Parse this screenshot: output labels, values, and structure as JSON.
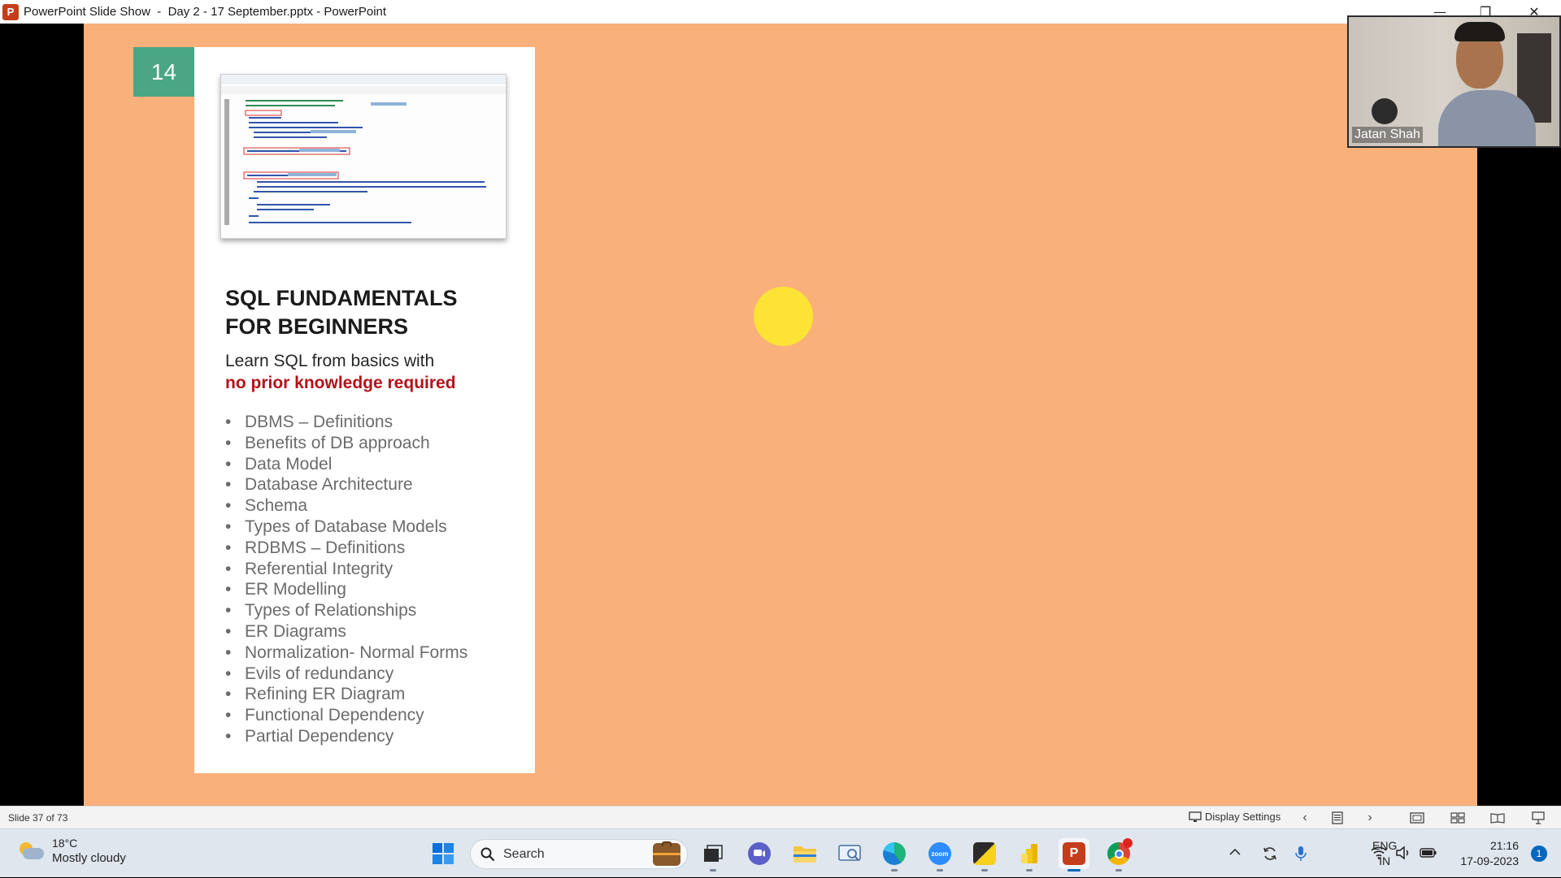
{
  "window": {
    "app_letter": "P",
    "title": "PowerPoint Slide Show  -  Day 2 - 17 September.pptx - PowerPoint",
    "controls": {
      "minimize": "—",
      "restore": "❐",
      "close": "✕"
    }
  },
  "slide": {
    "number": "14",
    "card": {
      "title": "SQL FUNDAMENTALS\nFOR BEGINNERS",
      "subtitle": "Learn SQL from basics with",
      "highlight": "no prior knowledge required",
      "topics": [
        "DBMS – Definitions",
        "Benefits of DB approach",
        "Data Model",
        "Database Architecture",
        "Schema",
        "Types of Database Models",
        "RDBMS – Definitions",
        "Referential Integrity",
        "ER Modelling",
        "Types of Relationships",
        "ER Diagrams",
        "Normalization- Normal Forms",
        "Evils of redundancy",
        "Refining ER Diagram",
        "Functional Dependency",
        "Partial Dependency"
      ]
    },
    "pointer_color": "#fde335"
  },
  "video": {
    "participant_name": "Jatan Shah"
  },
  "statusbar": {
    "slide_count": "Slide 37 of 73",
    "display_settings": "Display Settings",
    "icons": [
      "monitor-icon",
      "chevron-left-icon",
      "notes-icon",
      "chevron-right-icon",
      "normal-view-icon",
      "slide-sorter-icon",
      "reading-view-icon",
      "slideshow-icon"
    ]
  },
  "taskbar": {
    "weather": {
      "temp": "18°C",
      "desc": "Mostly cloudy"
    },
    "search_placeholder": "Search",
    "apps": [
      "windows-start",
      "search",
      "briefcase",
      "task-view",
      "teams-chat",
      "file-explorer",
      "snipping-tool",
      "edge",
      "zoom",
      "sticky-notes",
      "power-bi",
      "powerpoint",
      "chrome"
    ],
    "tray": {
      "lang_top": "ENG",
      "lang_bottom": "IN",
      "time": "21:16",
      "date": "17-09-2023",
      "notifications": "1"
    }
  },
  "colors": {
    "slide_bg": "#f9b07a",
    "badge": "#4aa684",
    "highlight_red": "#b3121a"
  }
}
